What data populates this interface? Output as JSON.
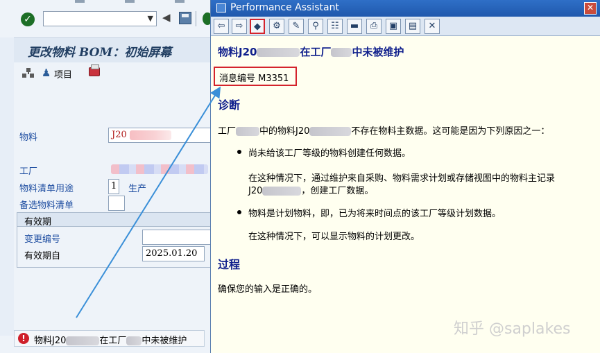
{
  "sap": {
    "title": "更改物料 BOM：初始屏幕",
    "toolbar": {
      "item_label": "项目"
    },
    "fields": {
      "material_label": "物料",
      "material_value": "J20",
      "plant_label": "工厂",
      "bom_usage_label": "物料清单用途",
      "bom_usage_value": "1",
      "bom_usage_text": "生产",
      "alt_bom_label": "备选物料清单"
    },
    "validity": {
      "header": "有效期",
      "change_number_label": "变更编号",
      "valid_from_label": "有效期自",
      "valid_from_value": "2025.01.20"
    },
    "statusbar": {
      "msg_part1": "物料J20",
      "msg_part2": "在工厂",
      "msg_part3": "中未被维护"
    }
  },
  "assistant": {
    "window_title": "Performance Assistant",
    "heading_part1": "物料J20",
    "heading_part2": "在工厂",
    "heading_part3": "中未被维护",
    "message_number": "消息编号 M3351",
    "diagnosis_title": "诊断",
    "diagnosis_part1": "工厂",
    "diagnosis_part2": "中的物料J20",
    "diagnosis_part3": "不存在物料主数据。这可能是因为下列原因之一：",
    "bullet1": "尚未给该工厂等级的物料创建任何数据。",
    "bullet1_detail1": "在这种情况下，通过维护来自采购、物料需求计划或存储视图中的物料主记录",
    "bullet1_detail2a": "J20",
    "bullet1_detail2b": "，创建工厂数据。",
    "bullet2": "物料是计划物料，即，已为将来时间点的该工厂等级计划数据。",
    "bullet2_detail": "在这种情况下，可以显示物料的计划更改。",
    "procedure_title": "过程",
    "procedure_text": "确保您的输入是正确的。"
  },
  "watermark": "知乎 @saplakes",
  "colors": {
    "highlight": "#d4232c",
    "heading": "#0f1f8c",
    "titlebar": "#2f6fc7"
  }
}
